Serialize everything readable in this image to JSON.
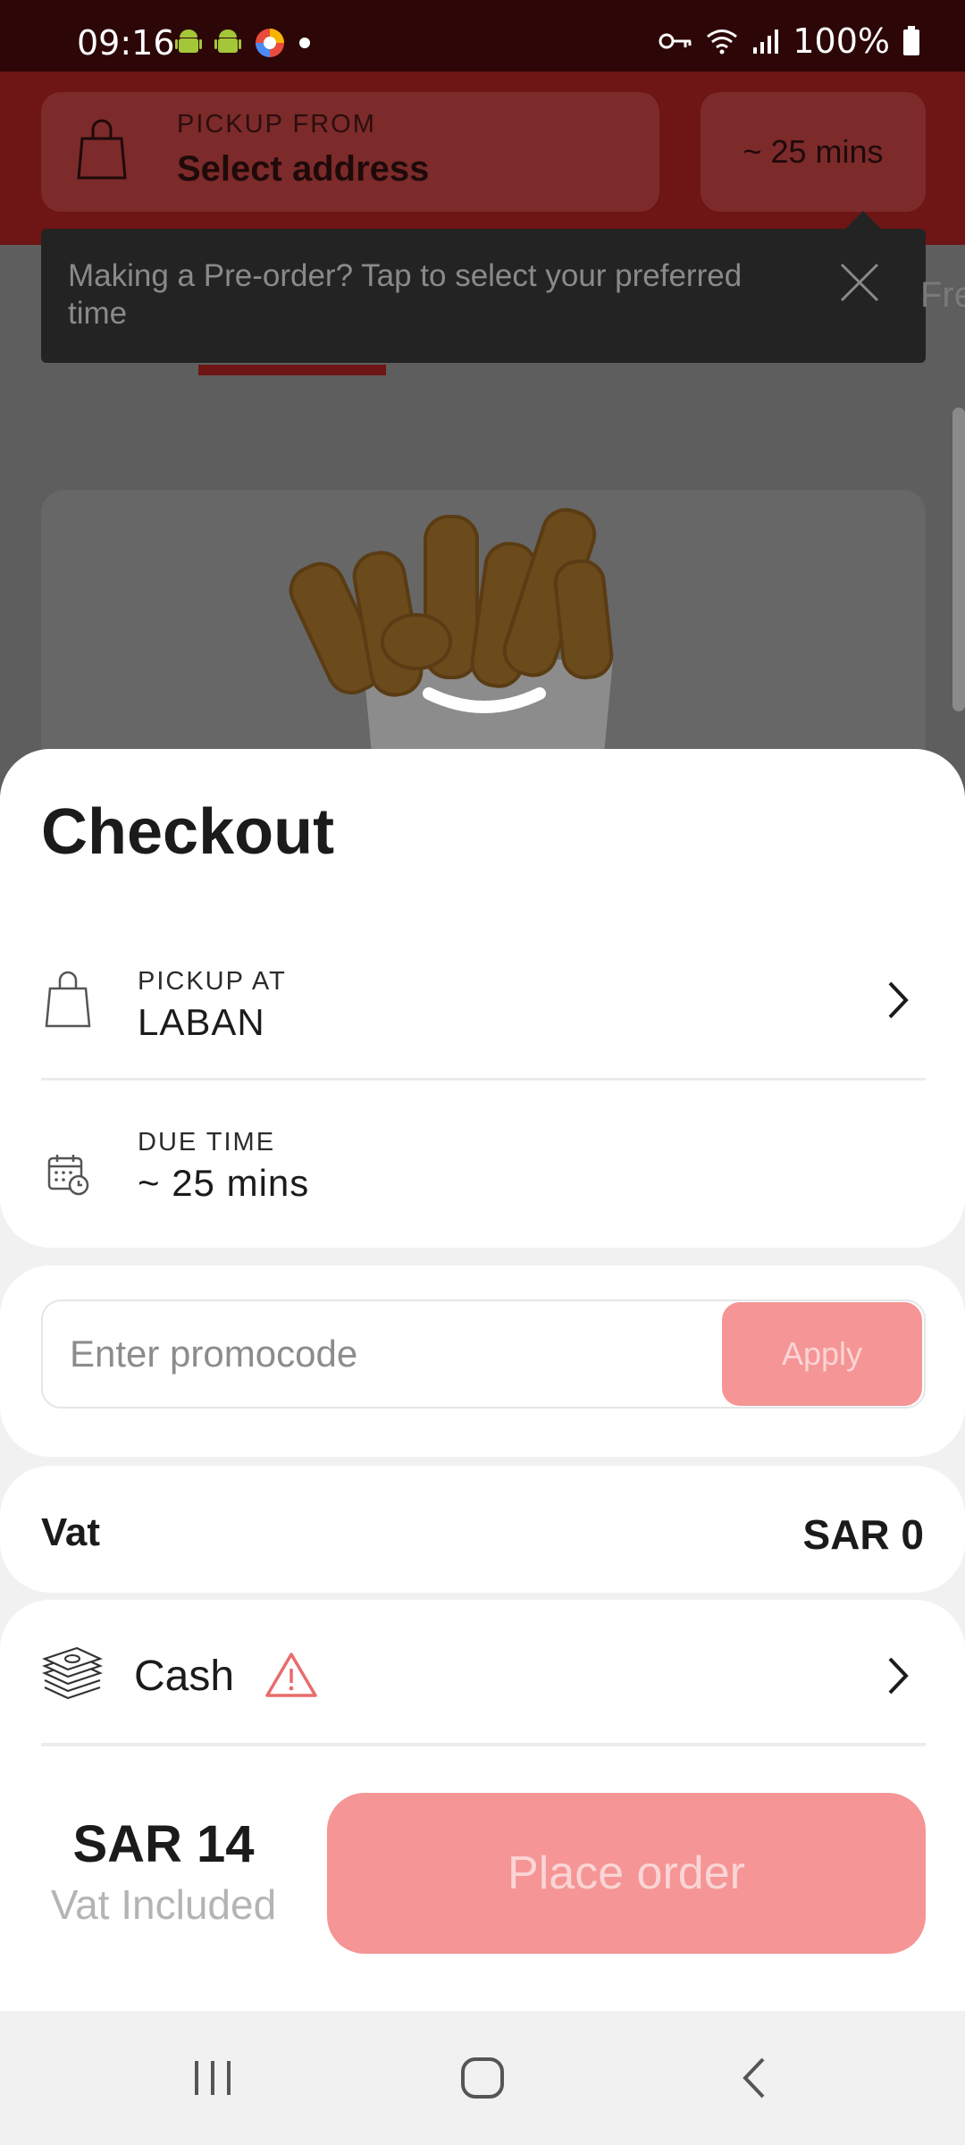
{
  "status_bar": {
    "time": "09:16",
    "battery": "100%"
  },
  "header": {
    "pickup_label": "PICKUP FROM",
    "pickup_value": "Select address",
    "eta": "~ 25 mins"
  },
  "tooltip": {
    "text": "Making a Pre-order? Tap to select your preferred time"
  },
  "background": {
    "tab_fragment": "Fre"
  },
  "checkout": {
    "title": "Checkout",
    "pickup": {
      "label": "PICKUP AT",
      "value": "LABAN"
    },
    "due": {
      "label": "DUE TIME",
      "value": "~ 25 mins"
    },
    "promo": {
      "placeholder": "Enter promocode",
      "apply_label": "Apply"
    },
    "vat": {
      "label": "Vat",
      "value": "SAR 0"
    },
    "payment": {
      "method": "Cash"
    },
    "total": {
      "amount": "SAR 14",
      "note": "Vat Included"
    },
    "place_order_label": "Place order"
  },
  "colors": {
    "accent": "#f59595",
    "brand_dark": "#6e1515"
  }
}
